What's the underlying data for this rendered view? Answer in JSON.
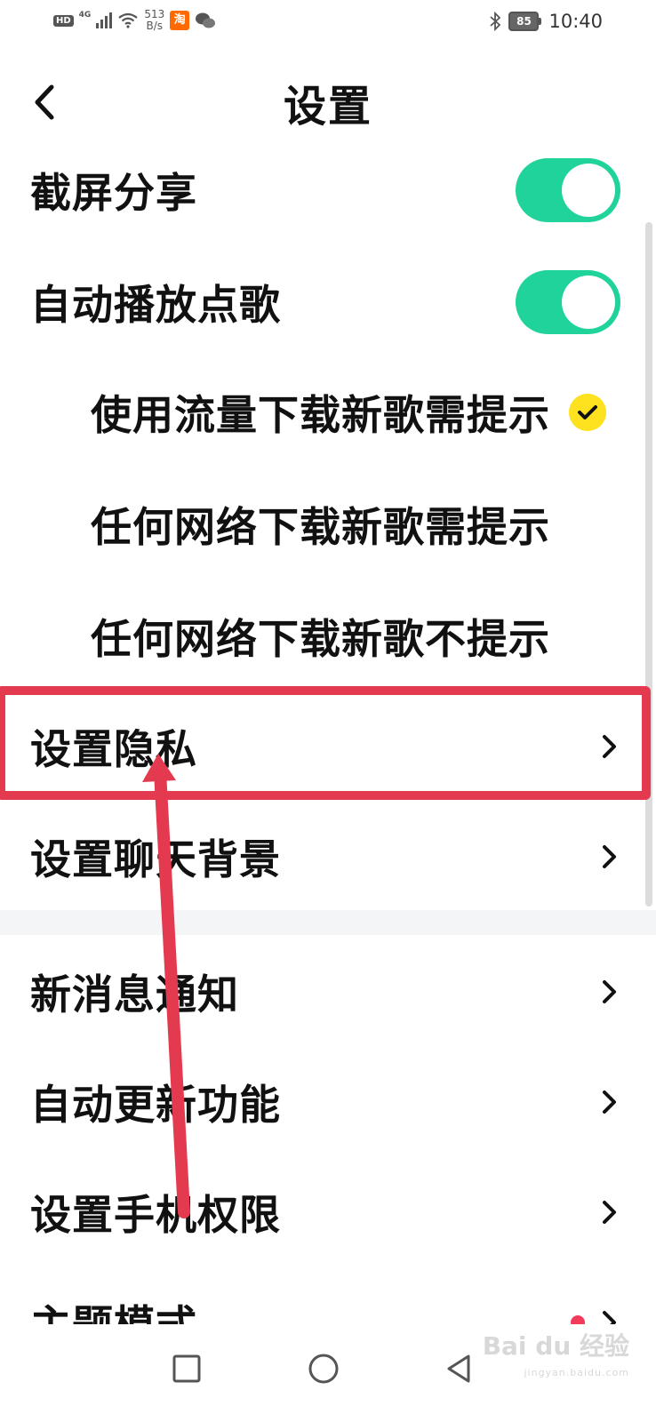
{
  "status_bar": {
    "hd": "HD",
    "network": "4G",
    "speed_value": "513",
    "speed_unit": "B/s",
    "taobao": "淘",
    "battery": "85",
    "time": "10:40"
  },
  "header": {
    "title": "设置"
  },
  "settings": {
    "screenshot_share": {
      "label": "截屏分享",
      "enabled": true
    },
    "autoplay_song": {
      "label": "自动播放点歌",
      "enabled": true
    },
    "download_options": [
      {
        "label": "使用流量下载新歌需提示",
        "selected": true
      },
      {
        "label": "任何网络下载新歌需提示",
        "selected": false
      },
      {
        "label": "任何网络下载新歌不提示",
        "selected": false
      }
    ],
    "privacy": {
      "label": "设置隐私"
    },
    "chat_background": {
      "label": "设置聊天背景"
    }
  },
  "more_settings": [
    {
      "label": "新消息通知"
    },
    {
      "label": "自动更新功能"
    },
    {
      "label": "设置手机权限"
    },
    {
      "label": "主题模式",
      "has_dot": true
    }
  ],
  "watermark": {
    "brand": "Bai du 经验",
    "url": "jingyan.baidu.com"
  },
  "colors": {
    "toggle_on": "#1fd39b",
    "check": "#ffe21f",
    "annotation": "#e43a4f"
  }
}
